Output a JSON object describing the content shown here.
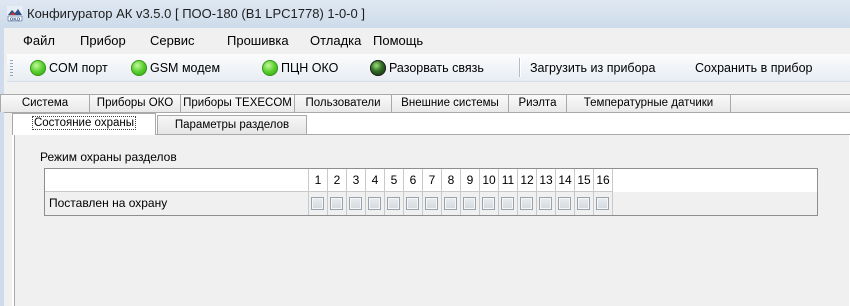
{
  "window": {
    "title": "Конфигуратор АК v3.5.0 [ ПОО-180 (B1 LPC1778) 1-0-0 ]",
    "icon": "oko-app-icon"
  },
  "menu": [
    {
      "label": "Файл"
    },
    {
      "label": "Прибор"
    },
    {
      "label": "Сервис"
    },
    {
      "label": "Прошивка"
    },
    {
      "label": "Отладка"
    },
    {
      "label": "Помощь"
    }
  ],
  "toolbar": {
    "com_port": {
      "label": "COM порт",
      "status": "connected",
      "color": "#57d02c"
    },
    "gsm_modem": {
      "label": "GSM модем",
      "status": "connected",
      "color": "#57d02c"
    },
    "pcn_oko": {
      "label": "ПЦН ОКО",
      "status": "connected",
      "color": "#57d02c"
    },
    "disconnect": {
      "label": "Разорвать связь",
      "color": "#2f6d25"
    },
    "load_from_device": {
      "label": "Загрузить из прибора"
    },
    "save_to_device": {
      "label": "Сохранить в прибор"
    }
  },
  "tabs": [
    {
      "label": "Система"
    },
    {
      "label": "Приборы ОКО"
    },
    {
      "label": "Приборы TEXECOM"
    },
    {
      "label": "Пользователи"
    },
    {
      "label": "Внешние системы"
    },
    {
      "label": "Риэлта"
    },
    {
      "label": "Температурные датчики"
    }
  ],
  "subtabs": [
    {
      "label": "Состояние охраны",
      "active": true
    },
    {
      "label": "Параметры разделов",
      "active": false
    }
  ],
  "section": {
    "title": "Режим охраны разделов",
    "columns": [
      "1",
      "2",
      "3",
      "4",
      "5",
      "6",
      "7",
      "8",
      "9",
      "10",
      "11",
      "12",
      "13",
      "14",
      "15",
      "16"
    ],
    "row": {
      "label": "Поставлен на охрану",
      "values": [
        false,
        false,
        false,
        false,
        false,
        false,
        false,
        false,
        false,
        false,
        false,
        false,
        false,
        false,
        false,
        false
      ]
    }
  }
}
